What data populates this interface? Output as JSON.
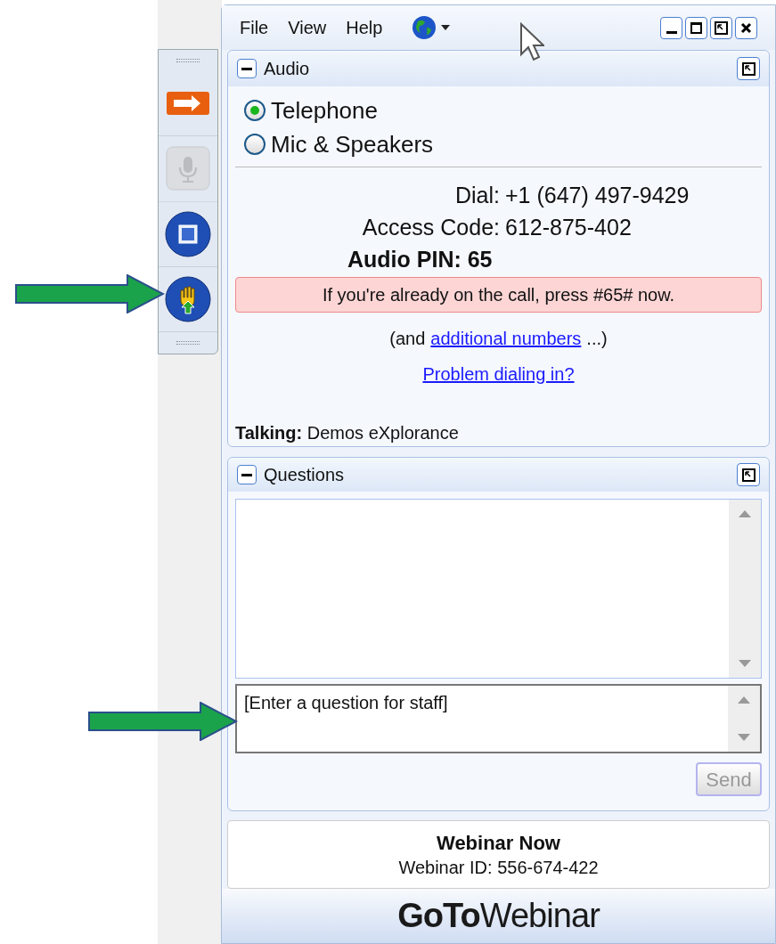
{
  "menu": [
    "File",
    "View",
    "Help"
  ],
  "toolbar": [
    {
      "kind": "arrow",
      "disabled": false
    },
    {
      "kind": "mic",
      "disabled": true
    },
    {
      "kind": "screen",
      "disabled": false
    },
    {
      "kind": "hand",
      "disabled": false
    }
  ],
  "audio": {
    "title": "Audio",
    "options": [
      {
        "label": "Telephone",
        "selected": true
      },
      {
        "label": "Mic & Speakers",
        "selected": false
      }
    ],
    "details": [
      {
        "label": "Dial:",
        "value": "+1 (647) 497-9429"
      },
      {
        "label": "Access Code:",
        "value": "612-875-402"
      }
    ],
    "pin": "Audio PIN: 65",
    "notice": "If you're already on the call, press #65# now.",
    "more_before": "(and",
    "more_link": "additional numbers",
    "more_after": "...)",
    "problem_link": "Problem dialing in?",
    "talking": "**Talking:** Demos eXplorance"
  },
  "questions": {
    "title": "Questions",
    "placeholder": "[Enter a question for staff]",
    "send": {
      "label": "Send",
      "disabled": true
    }
  },
  "footer": {
    "title": "Webinar Now",
    "id": "Webinar ID: 556-674-422",
    "logo_bold": "GoTo",
    "logo_light": "Webinar"
  }
}
